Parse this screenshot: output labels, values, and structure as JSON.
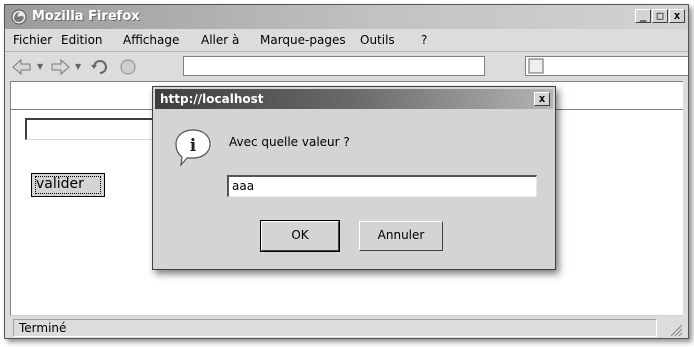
{
  "window": {
    "title": "Mozilla Firefox",
    "icon": "firefox-icon",
    "controls": [
      "_",
      "□",
      "x"
    ]
  },
  "menu": {
    "items": [
      {
        "label": "Fichier"
      },
      {
        "label": "Edition"
      },
      {
        "label": "Affichage"
      },
      {
        "label": "Aller à"
      },
      {
        "label": "Marque-pages"
      },
      {
        "label": "Outils"
      },
      {
        "label": "?"
      }
    ]
  },
  "toolbar": {
    "icons": [
      "back-arrow-icon",
      "forward-arrow-icon",
      "reload-icon",
      "stop-icon",
      "page-icon",
      "search-engine-icon"
    ]
  },
  "page": {
    "input_value": "",
    "button_label": "valider"
  },
  "status": {
    "text": "Terminé"
  },
  "dialog": {
    "title": "http://localhost",
    "close_label": "x",
    "message": "Avec quelle valeur ?",
    "input_value": "aaa",
    "ok_label": "OK",
    "cancel_label": "Annuler",
    "icon": "info-icon"
  }
}
